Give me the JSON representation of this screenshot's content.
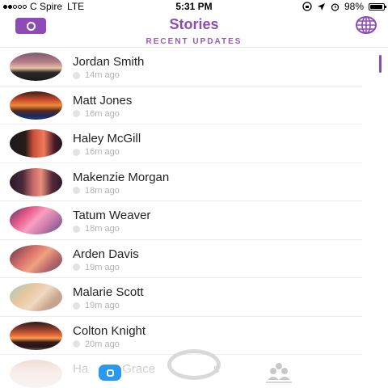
{
  "status_bar": {
    "carrier": "C Spire",
    "network": "LTE",
    "time": "5:31 PM",
    "battery": "98%"
  },
  "header": {
    "title": "Stories",
    "camera_icon": "camera-icon",
    "globe_icon": "globe-icon",
    "accent_color": "#8e4bb8"
  },
  "section": {
    "label": "RECENT UPDATES"
  },
  "stories": [
    {
      "name": "Jordan Smith",
      "time": "14m ago"
    },
    {
      "name": "Matt Jones",
      "time": "16m ago"
    },
    {
      "name": "Haley McGill",
      "time": "16m ago"
    },
    {
      "name": "Makenzie Morgan",
      "time": "18m ago"
    },
    {
      "name": "Tatum Weaver",
      "time": "18m ago"
    },
    {
      "name": "Arden Davis",
      "time": "19m ago"
    },
    {
      "name": "Malarie Scott",
      "time": "19m ago"
    },
    {
      "name": "Colton Knight",
      "time": "20m ago"
    },
    {
      "name": "Ha",
      "name_tail": "Grace",
      "name_end": "s",
      "time": ""
    }
  ],
  "bottom_bar": {
    "chat_icon": "chat-icon",
    "capture_icon": "capture-button-icon",
    "friends_icon": "friends-icon"
  }
}
